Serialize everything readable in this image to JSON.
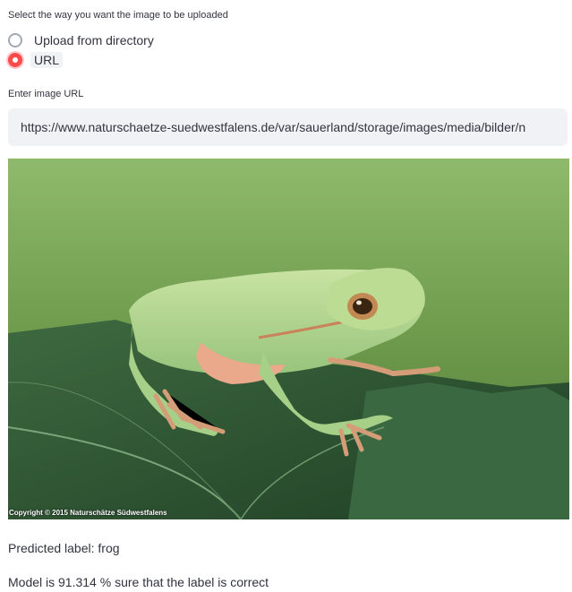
{
  "upload_mode": {
    "caption": "Select the way you want the image to be uploaded",
    "options": [
      {
        "label": "Upload from directory",
        "selected": false
      },
      {
        "label": "URL",
        "selected": true
      }
    ]
  },
  "url_input": {
    "caption": "Enter image URL",
    "value": "https://www.naturschaetze-suedwestfalens.de/var/sauerland/storage/images/media/bilder/n"
  },
  "image": {
    "subject": "tree frog on a leaf",
    "watermark": "Copyright © 2015 Naturschätze Südwestfalens"
  },
  "prediction": {
    "label_text": "Predicted label: frog",
    "confidence_text": "Model is 91.314 % sure that the label is correct"
  },
  "colors": {
    "accent": "#ff4b4b",
    "input_bg": "#f0f2f6"
  }
}
